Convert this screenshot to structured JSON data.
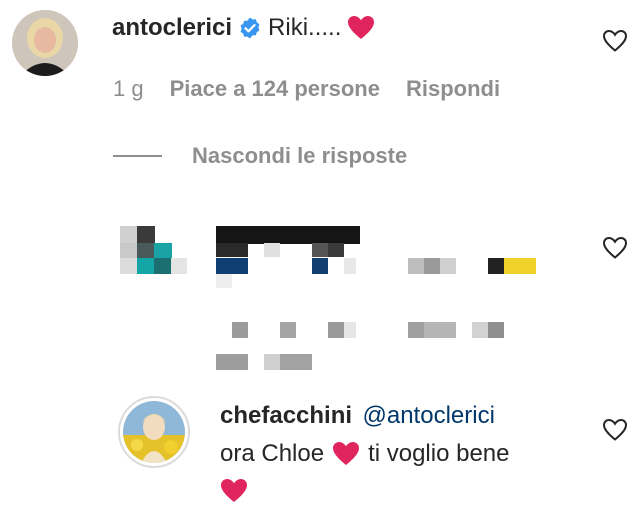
{
  "comment1": {
    "username": "antoclerici",
    "verified": true,
    "text": "Riki.....",
    "emoji": "❤️",
    "time": "1 g",
    "likes": "Piace a 124 persone",
    "reply_label": "Rispondi"
  },
  "replies_toggle": {
    "label": "Nascondi le risposte"
  },
  "comment3": {
    "username": "chefacchini",
    "mention": "@antoclerici",
    "text_line1": "ora Chloe",
    "text_line1_end": "ti voglio bene",
    "emoji": "❤️"
  },
  "colors": {
    "verified_blue": "#3897f0",
    "heart_red": "#e0245e",
    "meta_grey": "#8e8e8e",
    "mention_blue": "#00376b"
  },
  "icons": {
    "like": "heart-outline-icon",
    "verified": "verified-badge-icon"
  }
}
